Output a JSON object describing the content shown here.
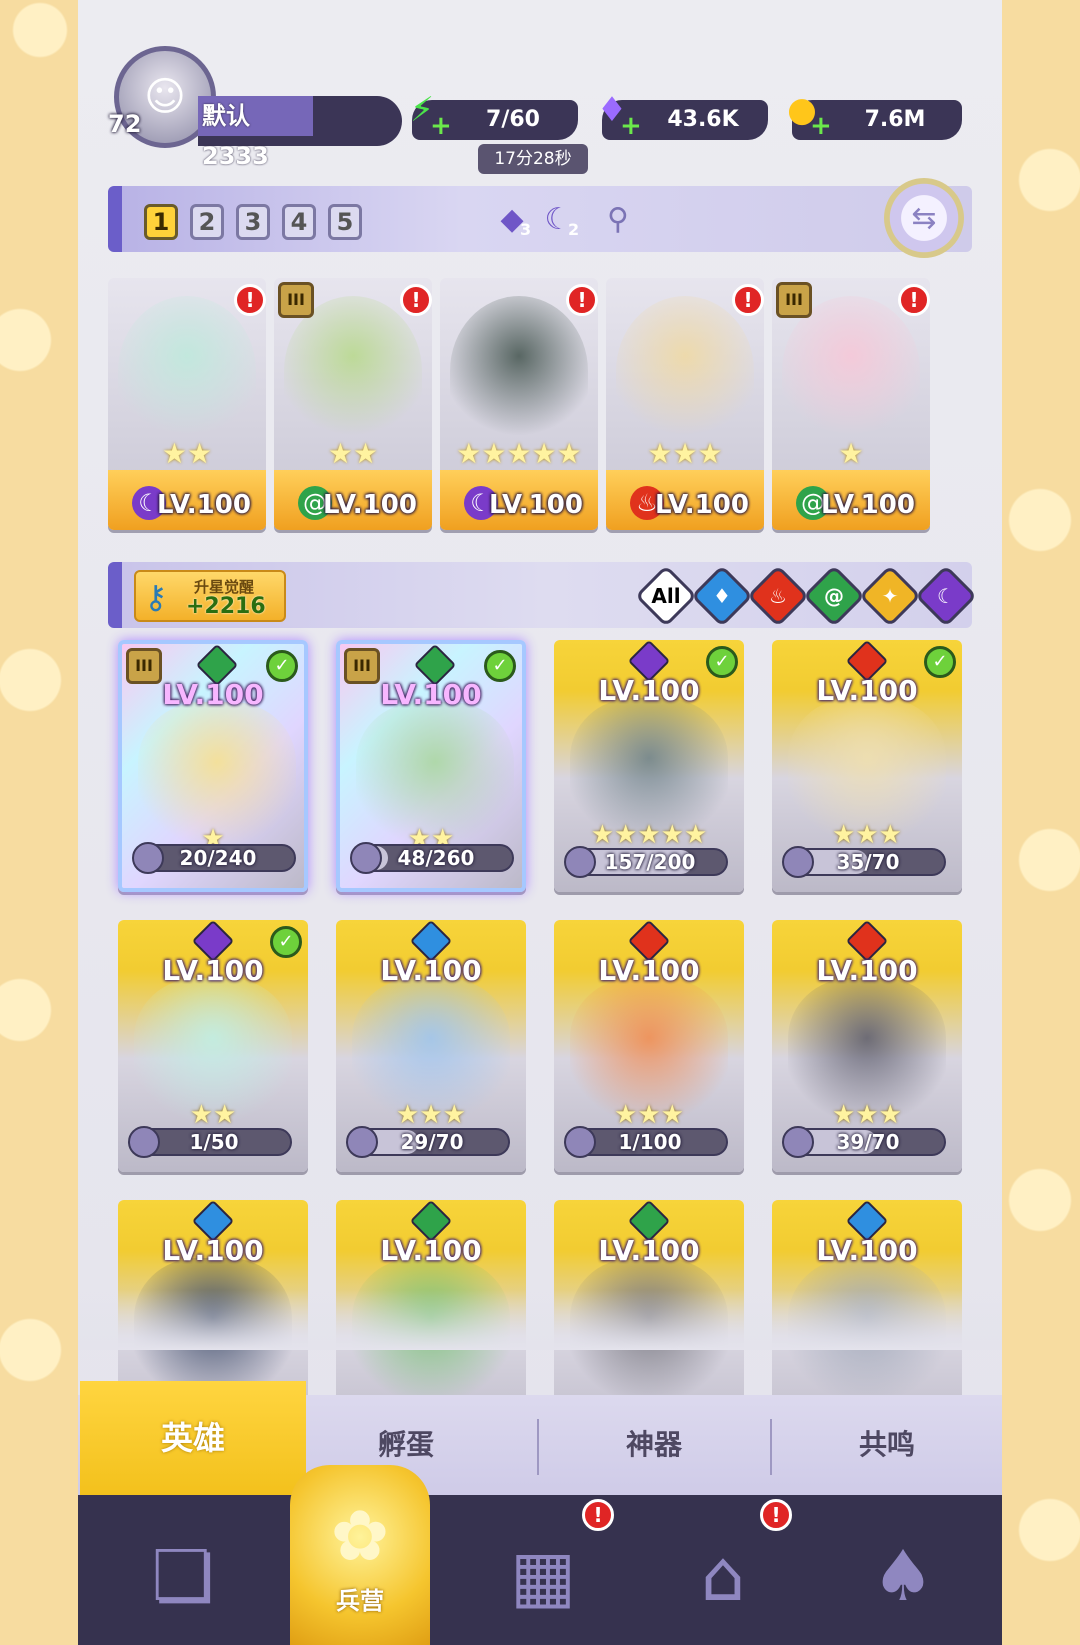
{
  "player": {
    "level": "72",
    "name": "默认2333"
  },
  "resources": {
    "energy": {
      "icon": "lightning-icon",
      "value": "7/60",
      "timer": "17分28秒"
    },
    "gems": {
      "icon": "diamond-icon",
      "value": "43.6K"
    },
    "coins": {
      "icon": "coin-icon",
      "value": "7.6M"
    }
  },
  "team_tabs": [
    "1",
    "2",
    "3",
    "4",
    "5"
  ],
  "team_active": "1",
  "team_gems": {
    "purple": "3",
    "dark": "2"
  },
  "team": [
    {
      "level": "LV.100",
      "stars": "★★",
      "element": "dark",
      "alert": "!",
      "rank": ""
    },
    {
      "level": "LV.100",
      "stars": "★★",
      "element": "wind",
      "alert": "!",
      "rank": "III"
    },
    {
      "level": "LV.100",
      "stars": "★★★★★",
      "element": "dark",
      "alert": "!",
      "rank": ""
    },
    {
      "level": "LV.100",
      "stars": "★★★",
      "element": "fire",
      "alert": "!",
      "rank": ""
    },
    {
      "level": "LV.100",
      "stars": "★",
      "element": "wind",
      "alert": "!",
      "rank": "III"
    }
  ],
  "awaken": {
    "label": "升星觉醒",
    "value": "+2216"
  },
  "filters": [
    "All",
    "water",
    "fire",
    "wind",
    "light",
    "dark"
  ],
  "filter_all_label": "All",
  "heroes": [
    {
      "level": "LV.100",
      "element": "wind",
      "check": true,
      "stars": "★",
      "progress": "20/240",
      "rank": "III",
      "selected": true,
      "frac": 0.083
    },
    {
      "level": "LV.100",
      "element": "wind",
      "check": true,
      "stars": "★★",
      "progress": "48/260",
      "rank": "III",
      "selected": true,
      "frac": 0.185
    },
    {
      "level": "LV.100",
      "element": "dark",
      "check": true,
      "stars": "★★★★★",
      "progress": "157/200",
      "rank": "",
      "selected": false,
      "frac": 0.785
    },
    {
      "level": "LV.100",
      "element": "fire",
      "check": true,
      "stars": "★★★",
      "progress": "35/70",
      "rank": "",
      "selected": false,
      "frac": 0.5
    },
    {
      "level": "LV.100",
      "element": "dark",
      "check": true,
      "stars": "★★",
      "progress": "1/50",
      "rank": "",
      "selected": false,
      "frac": 0.02
    },
    {
      "level": "LV.100",
      "element": "water",
      "check": false,
      "stars": "★★★",
      "progress": "29/70",
      "rank": "",
      "selected": false,
      "frac": 0.414
    },
    {
      "level": "LV.100",
      "element": "fire",
      "check": false,
      "stars": "★★★",
      "progress": "1/100",
      "rank": "",
      "selected": false,
      "frac": 0.01
    },
    {
      "level": "LV.100",
      "element": "fire",
      "check": false,
      "stars": "★★★",
      "progress": "39/70",
      "rank": "",
      "selected": false,
      "frac": 0.557
    },
    {
      "level": "LV.100",
      "element": "water",
      "check": false,
      "stars": "",
      "progress": "",
      "rank": "",
      "selected": false,
      "frac": 0
    },
    {
      "level": "LV.100",
      "element": "wind",
      "check": false,
      "stars": "",
      "progress": "",
      "rank": "",
      "selected": false,
      "frac": 0
    },
    {
      "level": "LV.100",
      "element": "wind",
      "check": false,
      "stars": "",
      "progress": "",
      "rank": "",
      "selected": false,
      "frac": 0
    },
    {
      "level": "LV.100",
      "element": "water",
      "check": false,
      "stars": "",
      "progress": "",
      "rank": "",
      "selected": false,
      "frac": 0
    }
  ],
  "tabs": [
    "英雄",
    "孵蛋",
    "神器",
    "共鸣"
  ],
  "nav": [
    {
      "icon": "cards-icon",
      "label": "",
      "alert": ""
    },
    {
      "icon": "barracks-icon",
      "label": "兵营",
      "alert": ""
    },
    {
      "icon": "map-icon",
      "label": "",
      "alert": "!"
    },
    {
      "icon": "temple-icon",
      "label": "",
      "alert": "!"
    },
    {
      "icon": "mushroom-icon",
      "label": "",
      "alert": ""
    }
  ],
  "colors": {
    "water": "#2f8fe0",
    "fire": "#e0321c",
    "wind": "#2fa34a",
    "light": "#f0b526",
    "dark": "#7a3bc9",
    "accent": "#f3c11c",
    "panel": "#e4e3ec",
    "nav": "#36324f"
  }
}
